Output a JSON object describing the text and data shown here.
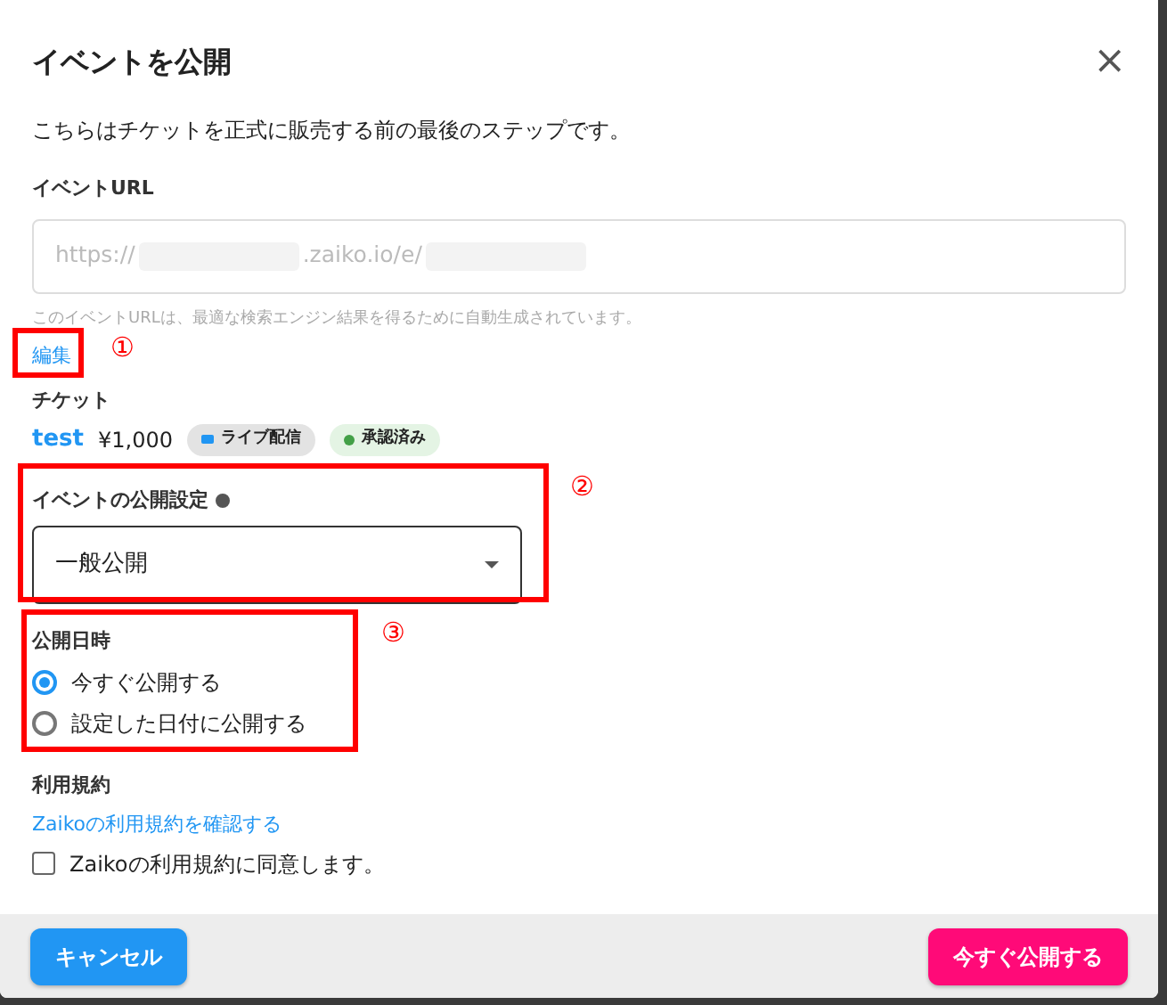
{
  "dialog": {
    "title": "イベントを公開",
    "close": "×"
  },
  "intro": "こちらはチケットを正式に販売する前の最後のステップです。",
  "url": {
    "label": "イベントURL",
    "parts": [
      {
        "kind": "text",
        "text": "https://"
      },
      {
        "kind": "blur"
      },
      {
        "kind": "text",
        "text": ".zaiko.io/e/"
      },
      {
        "kind": "blur"
      }
    ],
    "hint": "このイベントURLは、最適な検索エンジン結果を得るために自動生成されています。",
    "edit": "編集"
  },
  "ticket": {
    "label": "チケット",
    "name": "test",
    "price": "¥1,000",
    "tags": [
      {
        "text": "ライブ配信",
        "color": "#2196f3",
        "kind": "live"
      },
      {
        "text": "承認済み",
        "color": "#43a047",
        "kind": "ok"
      }
    ]
  },
  "visibility": {
    "label": "イベントの公開設定",
    "value": "一般公開"
  },
  "schedule": {
    "label": "公開日時",
    "options": [
      {
        "label": "今すぐ公開する",
        "selected": true
      },
      {
        "label": "設定した日付に公開する",
        "selected": false
      }
    ]
  },
  "terms": {
    "label": "利用規約",
    "link": "Zaikoの利用規約を確認する",
    "agree": "Zaikoの利用規約に同意します。",
    "checked": false
  },
  "footer": {
    "cancel": "キャンセル",
    "publish": "今すぐ公開する"
  },
  "annotations": [
    {
      "label": "①"
    },
    {
      "label": "②"
    },
    {
      "label": "③"
    }
  ]
}
